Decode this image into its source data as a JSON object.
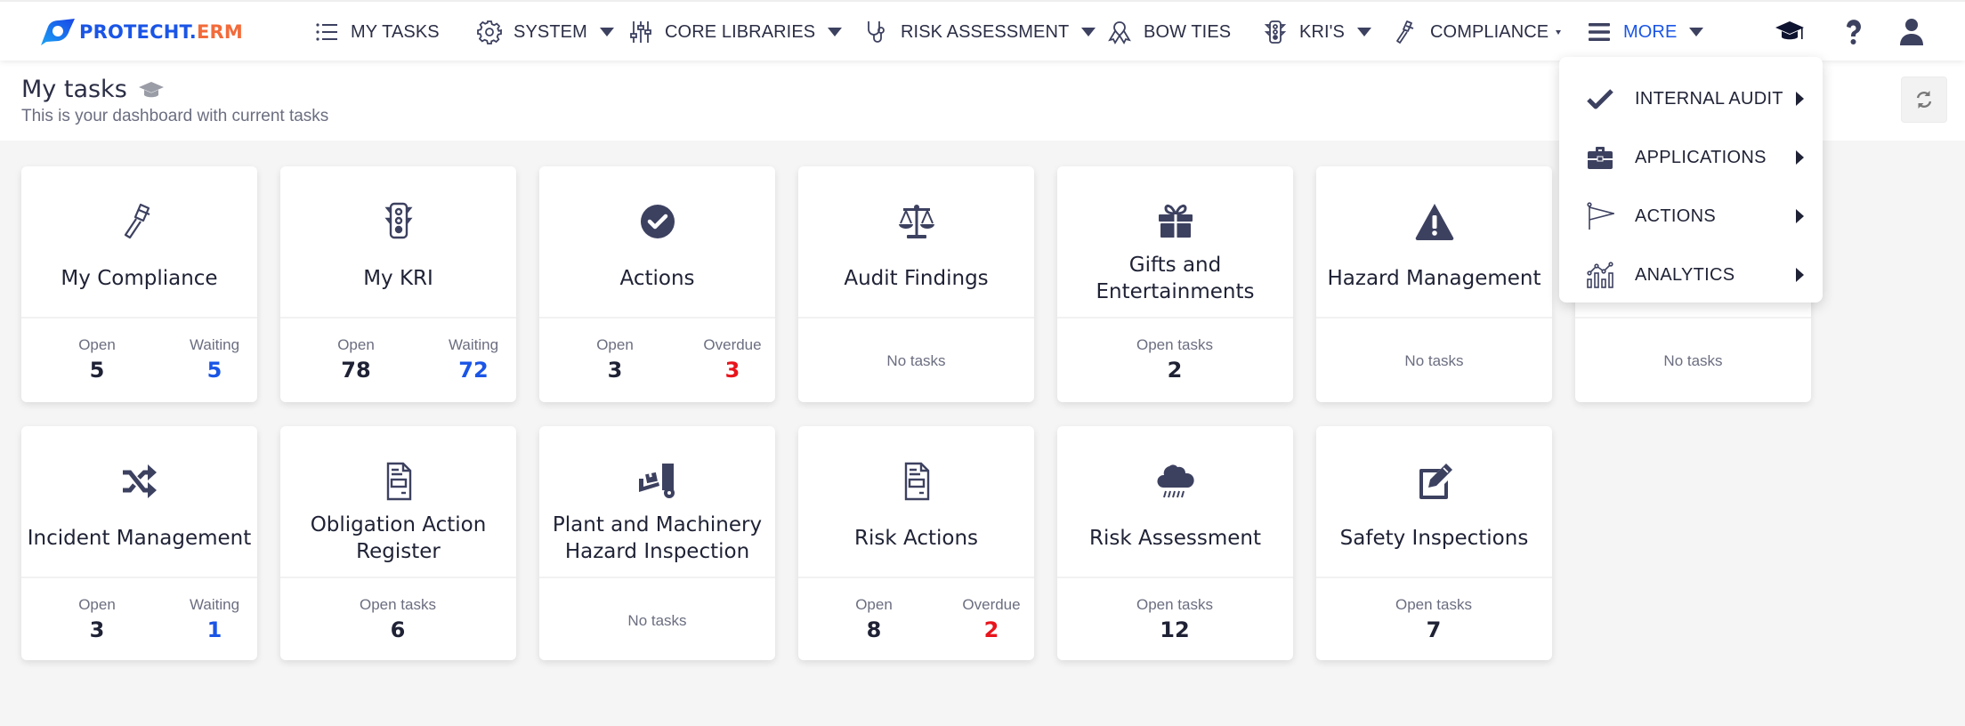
{
  "brand": {
    "name_part1": "PROTECHT.",
    "name_part2": "ERM",
    "color_primary": "#1a55e6",
    "color_secondary": "#f26b3a"
  },
  "nav": {
    "items": [
      {
        "label": "MY TASKS",
        "icon": "list-icon",
        "has_caret": false
      },
      {
        "label": "SYSTEM",
        "icon": "gear-icon",
        "has_caret": true
      },
      {
        "label": "CORE LIBRARIES",
        "icon": "sliders-icon",
        "has_caret": true
      },
      {
        "label": "RISK ASSESSMENT",
        "icon": "stethoscope-icon",
        "has_caret": true
      },
      {
        "label": "BOW TIES",
        "icon": "ribbon-icon",
        "has_caret": false
      },
      {
        "label": "KRI'S",
        "icon": "traffic-light-icon",
        "has_caret": true
      },
      {
        "label": "COMPLIANCE",
        "icon": "gavel-icon",
        "has_caret": true
      },
      {
        "label": "MORE",
        "icon": "hamburger-icon",
        "has_caret": true,
        "active": true
      }
    ],
    "right_icons": [
      "graduation-cap-icon",
      "help-icon",
      "user-icon"
    ]
  },
  "more_menu": {
    "items": [
      {
        "label": "INTERNAL AUDIT",
        "icon": "check-icon"
      },
      {
        "label": "APPLICATIONS",
        "icon": "toolbox-icon"
      },
      {
        "label": "ACTIONS",
        "icon": "flag-icon"
      },
      {
        "label": "ANALYTICS",
        "icon": "analytics-icon"
      }
    ]
  },
  "page": {
    "title": "My tasks",
    "subtitle": "This is your dashboard with current tasks",
    "refresh_icon": "refresh-icon"
  },
  "cards": [
    {
      "title": "My Compliance",
      "icon": "gavel-icon",
      "stats": [
        {
          "label": "Open",
          "value": "5",
          "tone": "default"
        },
        {
          "label": "Waiting",
          "value": "5",
          "tone": "blue"
        }
      ]
    },
    {
      "title": "My KRI",
      "icon": "traffic-light-icon",
      "stats": [
        {
          "label": "Open",
          "value": "78",
          "tone": "default"
        },
        {
          "label": "Waiting",
          "value": "72",
          "tone": "blue"
        }
      ]
    },
    {
      "title": "Actions",
      "icon": "check-circle-icon",
      "stats": [
        {
          "label": "Open",
          "value": "3",
          "tone": "default"
        },
        {
          "label": "Overdue",
          "value": "3",
          "tone": "red"
        }
      ]
    },
    {
      "title": "Audit Findings",
      "icon": "scales-icon",
      "no_tasks": "No tasks"
    },
    {
      "title": "Gifts and Entertainments",
      "icon": "gift-icon",
      "stats": [
        {
          "label": "Open tasks",
          "value": "2",
          "tone": "default"
        }
      ]
    },
    {
      "title": "Hazard Management",
      "icon": "warning-icon",
      "no_tasks": "No tasks"
    },
    {
      "title": "",
      "icon": "",
      "no_tasks": "No tasks"
    },
    {
      "title": "Incident Management",
      "icon": "shuffle-icon",
      "stats": [
        {
          "label": "Open",
          "value": "3",
          "tone": "default"
        },
        {
          "label": "Waiting",
          "value": "1",
          "tone": "blue"
        }
      ]
    },
    {
      "title": "Obligation Action Register",
      "icon": "document-icon",
      "stats": [
        {
          "label": "Open tasks",
          "value": "6",
          "tone": "default"
        }
      ]
    },
    {
      "title": "Plant and Machinery Hazard Inspection",
      "icon": "forklift-icon",
      "no_tasks": "No tasks"
    },
    {
      "title": "Risk Actions",
      "icon": "document-icon",
      "stats": [
        {
          "label": "Open",
          "value": "8",
          "tone": "default"
        },
        {
          "label": "Overdue",
          "value": "2",
          "tone": "red"
        }
      ]
    },
    {
      "title": "Risk Assessment",
      "icon": "rain-cloud-icon",
      "stats": [
        {
          "label": "Open tasks",
          "value": "12",
          "tone": "default"
        }
      ]
    },
    {
      "title": "Safety Inspections",
      "icon": "edit-icon",
      "stats": [
        {
          "label": "Open tasks",
          "value": "7",
          "tone": "default"
        }
      ]
    }
  ]
}
